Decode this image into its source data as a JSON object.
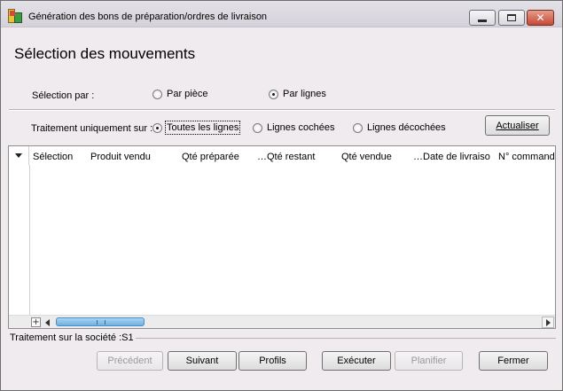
{
  "window": {
    "title": "Génération des bons de préparation/ordres de livraison"
  },
  "heading": "Sélection des mouvements",
  "selection": {
    "label": "Sélection par :",
    "options": [
      {
        "label": "Par pièce",
        "checked": false
      },
      {
        "label": "Par lignes",
        "checked": true
      }
    ]
  },
  "treatment": {
    "label": "Traitement uniquement sur :",
    "options": [
      {
        "label": "Toutes les lignes",
        "checked": true
      },
      {
        "label": "Lignes cochées",
        "checked": false
      },
      {
        "label": "Lignes décochées",
        "checked": false
      }
    ],
    "refresh_button": "Actualiser"
  },
  "grid": {
    "columns": [
      "Sélection",
      "Produit vendu",
      "Qté préparée",
      "…Qté restant",
      "Qté vendue",
      "…Date de livraiso",
      "N° commande"
    ],
    "rows": []
  },
  "footer": {
    "company_label": "Traitement sur la société :S1"
  },
  "buttons": {
    "previous": "Précédent",
    "next": "Suivant",
    "profiles": "Profils",
    "execute": "Exécuter",
    "schedule": "Planifier",
    "close": "Fermer"
  }
}
